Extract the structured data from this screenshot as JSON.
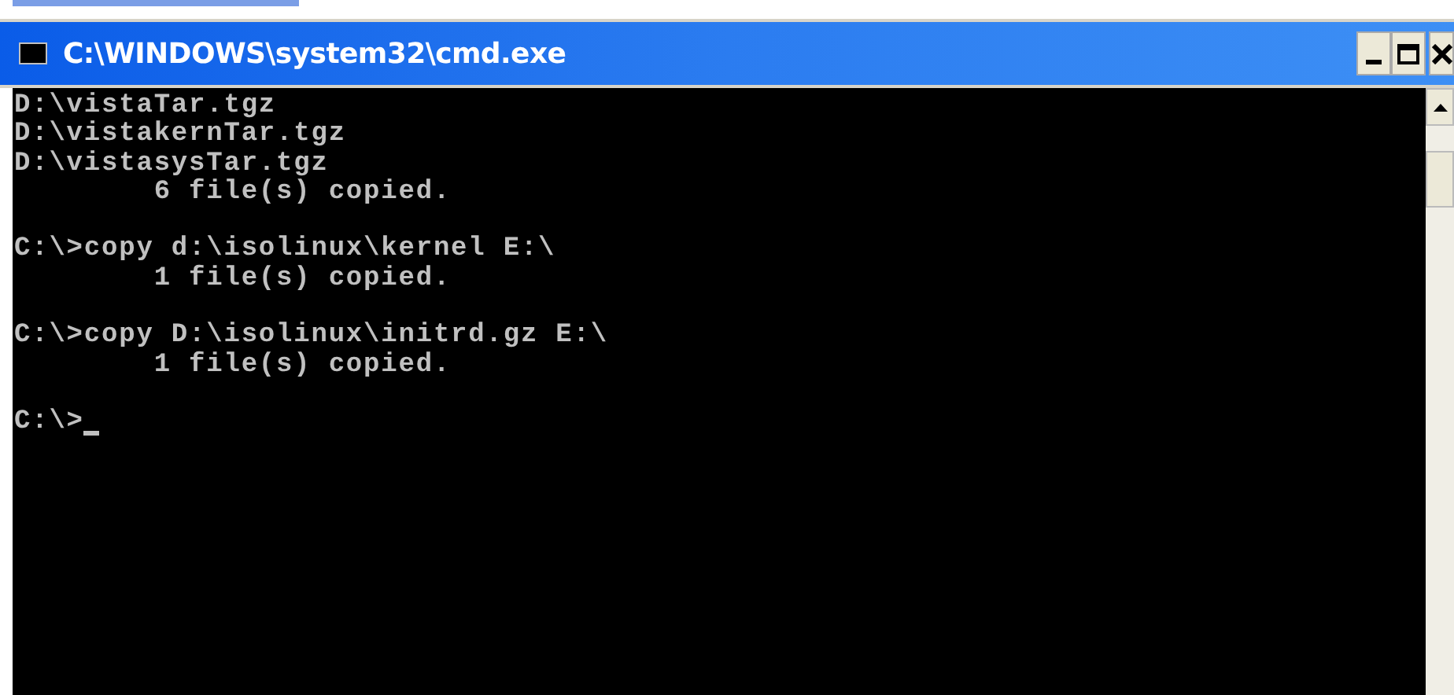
{
  "window": {
    "title": "C:\\WINDOWS\\system32\\cmd.exe"
  },
  "console": {
    "blocks": [
      [
        "D:\\vistaTar.tgz",
        "D:\\vistakernTar.tgz",
        "D:\\vistasysTar.tgz",
        "        6 file(s) copied."
      ],
      [
        "C:\\>copy d:\\isolinux\\kernel E:\\",
        "        1 file(s) copied."
      ],
      [
        "C:\\>copy D:\\isolinux\\initrd.gz E:\\",
        "        1 file(s) copied."
      ],
      [
        "C:\\>"
      ]
    ],
    "cursor": true
  }
}
